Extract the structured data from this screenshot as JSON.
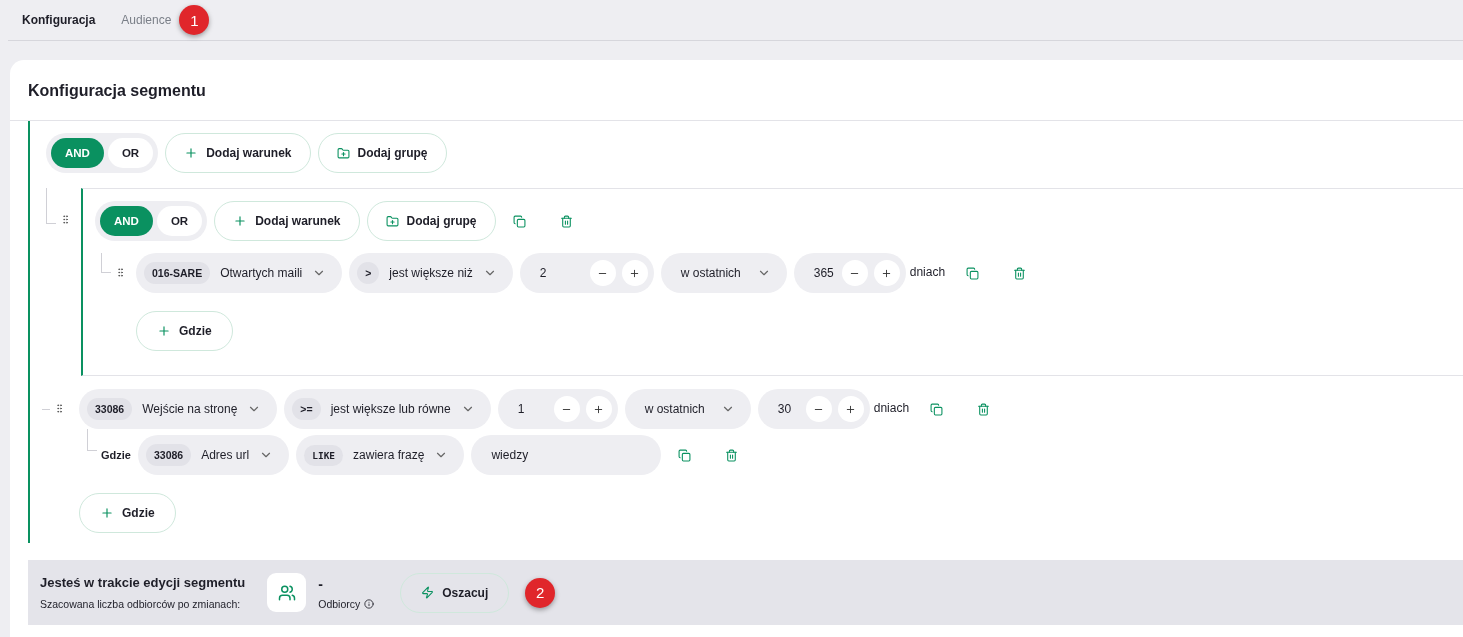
{
  "tabs": [
    {
      "label": "Konfiguracja",
      "selected": true
    },
    {
      "label": "Audience",
      "selected": false
    }
  ],
  "tabs_marker": "1",
  "panel": {
    "title": "Konfiguracja segmentu",
    "root": {
      "operators": [
        {
          "label": "AND",
          "selected": true
        },
        {
          "label": "OR",
          "selected": false
        }
      ],
      "add_condition": "Dodaj warunek",
      "add_group": "Dodaj grupę",
      "items": [
        {
          "kind": "group",
          "operators": [
            {
              "label": "AND",
              "selected": true
            },
            {
              "label": "OR",
              "selected": false
            }
          ],
          "add_condition": "Dodaj warunek",
          "add_group": "Dodaj grupę",
          "conditions": [
            {
              "attribute": {
                "code": "016-SARE",
                "label": "Otwartych maili"
              },
              "operator": {
                "symbol": ">",
                "label": "jest większe niż"
              },
              "value": "2",
              "period": "w ostatnich",
              "days": "365",
              "unit": "dniach",
              "add_where": "Gdzie"
            }
          ]
        },
        {
          "kind": "condition",
          "attribute": {
            "code": "33086",
            "label": "Wejście na stronę"
          },
          "operator": {
            "symbol": ">=",
            "label": "jest większe lub równe"
          },
          "value": "1",
          "period": "w ostatnich",
          "days": "30",
          "unit": "dniach",
          "filters": [
            {
              "prefix": "Gdzie",
              "attribute": {
                "code": "33086",
                "label": "Adres url"
              },
              "operator": {
                "symbol": "LIKE",
                "label": "zawiera frazę"
              },
              "value": "wiedzy"
            }
          ],
          "add_where": "Gdzie"
        }
      ]
    }
  },
  "footer": {
    "title": "Jesteś w trakcie edycji segmentu",
    "subtitle": "Szacowana liczba odbiorców po zmianach:",
    "count": "-",
    "count_label": "Odbiorcy",
    "button": "Oszacuj",
    "marker": "2"
  }
}
